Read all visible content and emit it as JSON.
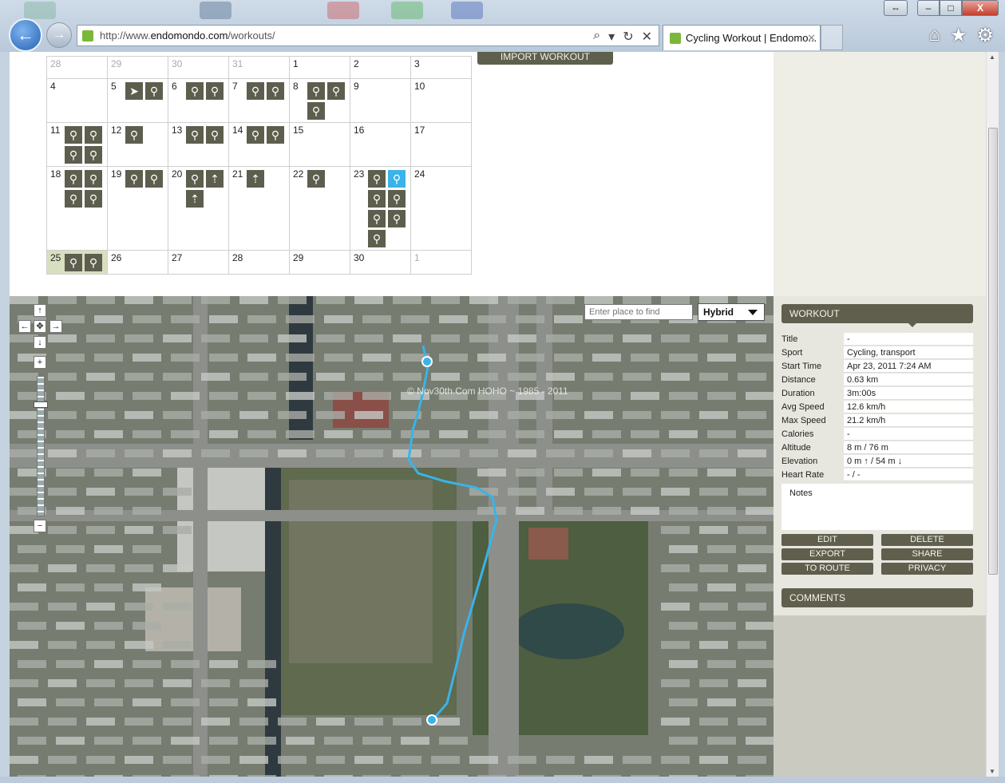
{
  "browser": {
    "url_prefix": "http://www.",
    "url_domain": "endomondo.com",
    "url_path": "/workouts/",
    "tab_title": "Cycling Workout | Endomo...",
    "tab_close": "✕",
    "back": "←",
    "forward": "→",
    "search_glyph": "⌕",
    "dropdown_glyph": "▾",
    "refresh_glyph": "↻",
    "stop_glyph": "✕",
    "home_glyph": "⌂",
    "favorites_glyph": "★",
    "tools_glyph": "⚙",
    "window_resize": "⇔",
    "window_min": "–",
    "window_max": "□",
    "window_close": "X"
  },
  "import_button": "IMPORT WORKOUT",
  "calendar": {
    "weeks": [
      [
        {
          "day": "28",
          "muted": true,
          "icons": []
        },
        {
          "day": "29",
          "muted": true,
          "icons": []
        },
        {
          "day": "30",
          "muted": true,
          "icons": []
        },
        {
          "day": "31",
          "muted": true,
          "icons": []
        },
        {
          "day": "1",
          "icons": []
        },
        {
          "day": "2",
          "icons": []
        },
        {
          "day": "3",
          "icons": []
        }
      ],
      [
        {
          "day": "4",
          "icons": []
        },
        {
          "day": "5",
          "icons": [
            "run",
            "bike"
          ]
        },
        {
          "day": "6",
          "icons": [
            "bike",
            "bike"
          ]
        },
        {
          "day": "7",
          "icons": [
            "bike",
            "bike"
          ]
        },
        {
          "day": "8",
          "icons": [
            "bike",
            "bike",
            "bike"
          ]
        },
        {
          "day": "9",
          "icons": []
        },
        {
          "day": "10",
          "icons": []
        }
      ],
      [
        {
          "day": "11",
          "icons": [
            "bike",
            "bike",
            "bike",
            "bike"
          ]
        },
        {
          "day": "12",
          "icons": [
            "bike"
          ]
        },
        {
          "day": "13",
          "icons": [
            "bike",
            "bike"
          ]
        },
        {
          "day": "14",
          "icons": [
            "bike",
            "bike"
          ]
        },
        {
          "day": "15",
          "icons": []
        },
        {
          "day": "16",
          "icons": []
        },
        {
          "day": "17",
          "icons": []
        }
      ],
      [
        {
          "day": "18",
          "icons": [
            "bike",
            "bike",
            "bike",
            "bike"
          ]
        },
        {
          "day": "19",
          "icons": [
            "bike",
            "bike"
          ]
        },
        {
          "day": "20",
          "icons": [
            "bike",
            "walk",
            "walk"
          ]
        },
        {
          "day": "21",
          "icons": [
            "walk"
          ]
        },
        {
          "day": "22",
          "icons": [
            "bike"
          ]
        },
        {
          "day": "23",
          "icons": [
            "bike",
            "bike-selected",
            "bike",
            "bike",
            "bike",
            "bike",
            "bike"
          ]
        },
        {
          "day": "24",
          "icons": []
        }
      ],
      [
        {
          "day": "25",
          "today": true,
          "icons": [
            "bike",
            "bike"
          ]
        },
        {
          "day": "26",
          "icons": []
        },
        {
          "day": "27",
          "icons": []
        },
        {
          "day": "28",
          "icons": []
        },
        {
          "day": "29",
          "icons": []
        },
        {
          "day": "30",
          "icons": []
        },
        {
          "day": "1",
          "muted": true,
          "icons": []
        }
      ]
    ]
  },
  "map": {
    "search_placeholder": "Enter place to find",
    "type": "Hybrid",
    "watermark": "© Nov30th.Com HOHO ~ 1985 - 2011",
    "route_color": "#3ab3e8",
    "controls": {
      "up": "↑",
      "left": "←",
      "center": "✥",
      "right": "→",
      "down": "↓",
      "zoom_in": "+",
      "zoom_out": "−"
    }
  },
  "workout": {
    "header": "WORKOUT",
    "fields": [
      {
        "label": "Title",
        "value": "-"
      },
      {
        "label": "Sport",
        "value": "Cycling, transport"
      },
      {
        "label": "Start Time",
        "value": "Apr 23, 2011 7:24 AM"
      },
      {
        "label": "Distance",
        "value": "0.63 km"
      },
      {
        "label": "Duration",
        "value": "3m:00s"
      },
      {
        "label": "Avg Speed",
        "value": "12.6 km/h"
      },
      {
        "label": "Max Speed",
        "value": "21.2 km/h"
      },
      {
        "label": "Calories",
        "value": "-"
      },
      {
        "label": "Altitude",
        "value": "8 m / 76 m"
      },
      {
        "label": "Elevation",
        "value": "0 m ↑ / 54 m ↓"
      },
      {
        "label": "Heart Rate",
        "value": "- / -"
      }
    ],
    "notes_label": "Notes",
    "actions": {
      "edit": "EDIT",
      "delete": "DELETE",
      "export": "EXPORT",
      "share": "SHARE",
      "to_route": "TO ROUTE",
      "privacy": "PRIVACY"
    }
  },
  "comments_header": "COMMENTS",
  "scrollbar": {
    "up": "▲",
    "down": "▼"
  }
}
